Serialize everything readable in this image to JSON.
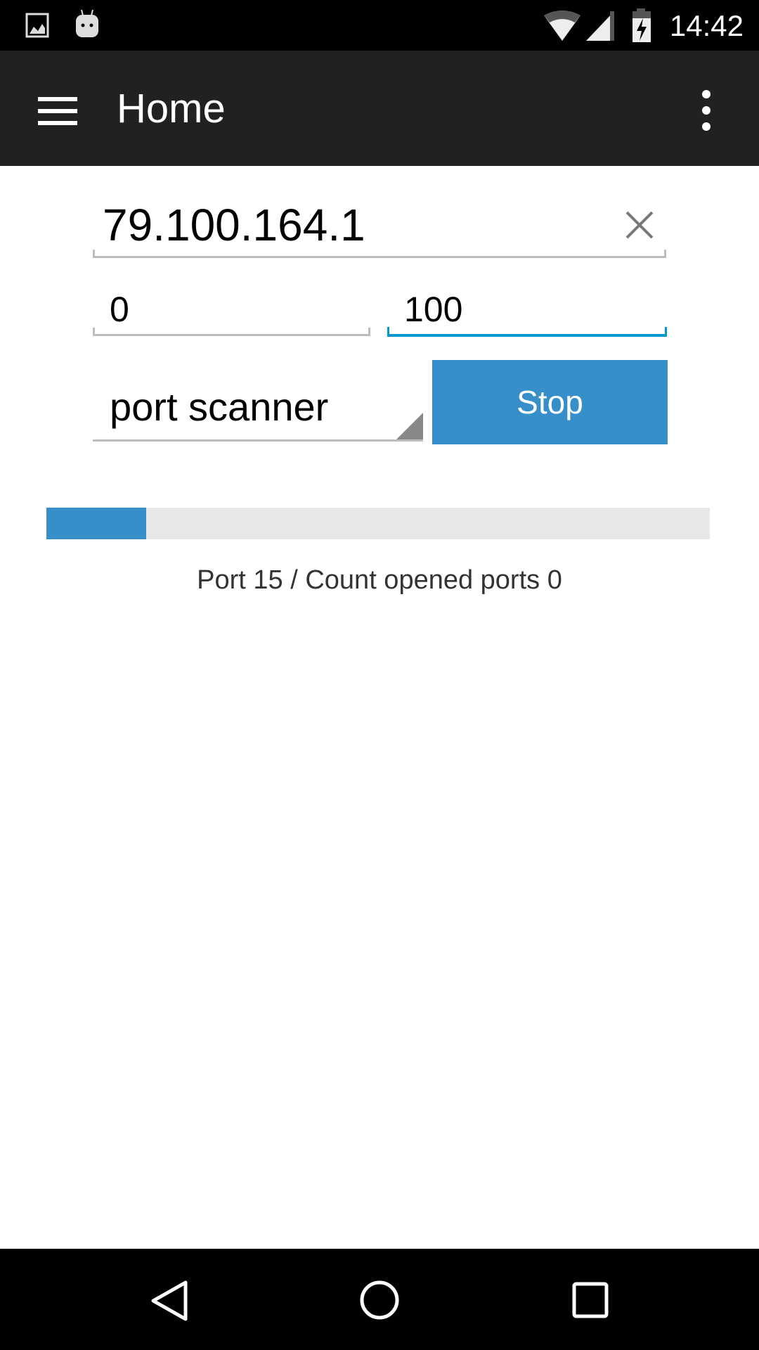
{
  "status_bar": {
    "time": "14:42",
    "icons": [
      "image-notification-icon",
      "android-notification-icon",
      "wifi-icon",
      "signal-icon",
      "battery-charging-icon"
    ]
  },
  "toolbar": {
    "title": "Home",
    "menu_icon": "hamburger-menu-icon",
    "overflow_icon": "more-vert-icon"
  },
  "form": {
    "host_value": "79.100.164.1",
    "port_from_value": "0",
    "port_to_value": "100",
    "mode_selected": "port scanner",
    "stop_label": "Stop"
  },
  "progress": {
    "percent": 15,
    "status_text": "Port 15 / Count opened ports 0"
  },
  "colors": {
    "accent": "#368fc8",
    "focus": "#0099cc",
    "toolbar": "#212121"
  },
  "nav_bar": {
    "icons": [
      "back-icon",
      "home-icon",
      "recents-icon"
    ]
  }
}
